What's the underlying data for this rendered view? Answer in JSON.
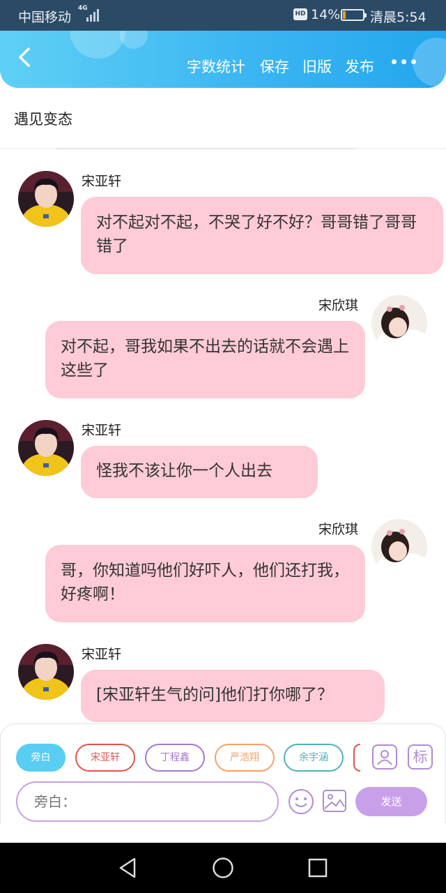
{
  "status": {
    "carrier": "中国移动",
    "network": "4G",
    "hd": "HD",
    "battery": "14%",
    "battery_level": 0.14,
    "time": "清晨5:54"
  },
  "header": {
    "word_count": "字数统计",
    "save": "保存",
    "old_version": "旧版",
    "publish": "发布"
  },
  "title": "遇见变态",
  "messages": [
    {
      "speaker": "宋亚轩",
      "text": "对不起对不起，不哭了好不好？哥哥错了哥哥错了"
    },
    {
      "speaker": "宋欣琪",
      "text": "对不起，哥我如果不出去的话就不会遇上这些了"
    },
    {
      "speaker": "宋亚轩",
      "text": "怪我不该让你一个人出去"
    },
    {
      "speaker": "宋欣琪",
      "text": "哥，你知道吗他们好吓人，他们还打我，好疼啊！"
    },
    {
      "speaker": "宋亚轩",
      "text": "[宋亚轩生气的问]他们打你哪了？"
    }
  ],
  "roles": [
    {
      "label": "旁白",
      "color": "#59cdf2"
    },
    {
      "label": "宋亚轩",
      "color": "#e0534c"
    },
    {
      "label": "丁程鑫",
      "color": "#a678d1"
    },
    {
      "label": "严浩翔",
      "color": "#f2a267"
    },
    {
      "label": "余宇涵",
      "color": "#4fb0b8"
    }
  ],
  "tools": {
    "mark_label": "标"
  },
  "input": {
    "placeholder": "旁白："
  },
  "send_label": "发送"
}
